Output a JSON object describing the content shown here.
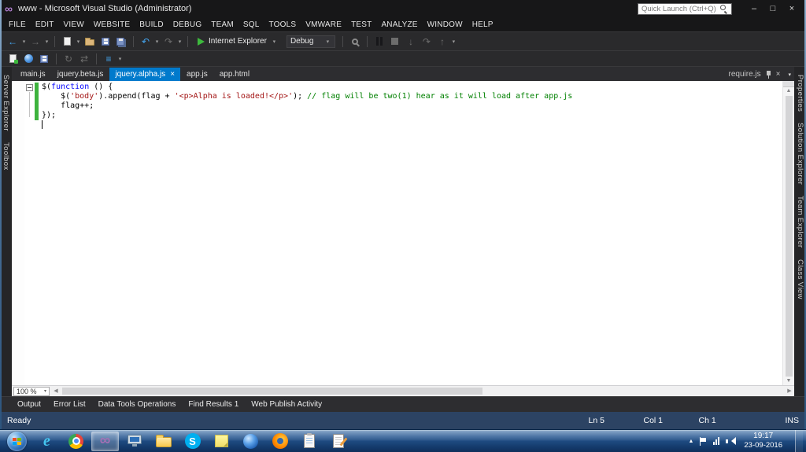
{
  "title_bar": {
    "title": "www - Microsoft Visual Studio (Administrator)",
    "quick_launch_placeholder": "Quick Launch (Ctrl+Q)",
    "window_controls": {
      "minimize": "–",
      "maximize": "□",
      "close": "×"
    }
  },
  "menu_bar": {
    "items": [
      "FILE",
      "EDIT",
      "VIEW",
      "WEBSITE",
      "BUILD",
      "DEBUG",
      "TEAM",
      "SQL",
      "TOOLS",
      "VMWARE",
      "TEST",
      "ANALYZE",
      "WINDOW",
      "HELP"
    ]
  },
  "glyphs": {
    "caret": "▾",
    "close": "×",
    "scroll_up": "▲",
    "scroll_down": "▼",
    "scroll_left": "◀",
    "scroll_right": "▶"
  },
  "toolbar_main": [
    {
      "type": "icon",
      "name": "navigate-back-icon",
      "glyph": "←",
      "color": "#44a6f1"
    },
    {
      "type": "caret",
      "name": "navigate-back-dropdown-icon"
    },
    {
      "type": "icon",
      "name": "navigate-forward-icon",
      "glyph": "→",
      "color": "#6d6d6d"
    },
    {
      "type": "caret",
      "name": "navigate-forward-dropdown-icon"
    },
    {
      "type": "sep"
    },
    {
      "type": "icon",
      "name": "new-file-icon",
      "shape": "page"
    },
    {
      "type": "caret",
      "name": "new-file-dropdown-icon"
    },
    {
      "type": "icon",
      "name": "open-file-icon",
      "shape": "folder"
    },
    {
      "type": "icon",
      "name": "save-icon",
      "shape": "floppy"
    },
    {
      "type": "icon",
      "name": "save-all-icon",
      "shape": "floppy2"
    },
    {
      "type": "sep"
    },
    {
      "type": "icon",
      "name": "undo-icon",
      "glyph": "↶",
      "color": "#44a6f1"
    },
    {
      "type": "caret",
      "name": "undo-dropdown-icon"
    },
    {
      "type": "icon",
      "name": "redo-icon",
      "glyph": "↷",
      "color": "#6d6d6d"
    },
    {
      "type": "caret",
      "name": "redo-dropdown-icon"
    },
    {
      "type": "sep"
    },
    {
      "type": "run",
      "name": "start-debug-button",
      "label": "Internet Explorer"
    },
    {
      "type": "combo",
      "name": "solution-configurations-combobox",
      "label": "Debug"
    },
    {
      "type": "sep"
    },
    {
      "type": "icon",
      "name": "find-in-files-icon",
      "shape": "find"
    },
    {
      "type": "sep"
    },
    {
      "type": "icon",
      "name": "break-all-icon",
      "shape": "pause"
    },
    {
      "type": "icon",
      "name": "stop-debug-icon",
      "shape": "stop"
    },
    {
      "type": "icon",
      "name": "step-into-icon",
      "glyph": "↓",
      "color": "#6d6d6d"
    },
    {
      "type": "icon",
      "name": "step-over-icon",
      "glyph": "↷",
      "color": "#6d6d6d"
    },
    {
      "type": "icon",
      "name": "step-out-icon",
      "glyph": "↑",
      "color": "#6d6d6d"
    },
    {
      "type": "caret",
      "name": "toolbar-overflow-icon"
    }
  ],
  "toolbar_web": [
    {
      "type": "icon",
      "name": "add-new-item-icon",
      "shape": "page-plus"
    },
    {
      "type": "icon",
      "name": "open-web-site-icon",
      "shape": "globe-sm"
    },
    {
      "type": "icon",
      "name": "save-web-icon",
      "shape": "floppy"
    },
    {
      "type": "sep"
    },
    {
      "type": "icon",
      "name": "refresh-icon",
      "glyph": "↻",
      "color": "#6d6d6d"
    },
    {
      "type": "icon",
      "name": "sync-icon",
      "glyph": "⇄",
      "color": "#6d6d6d"
    },
    {
      "type": "sep"
    },
    {
      "type": "icon",
      "name": "task-list-icon",
      "glyph": "≡",
      "color": "#44a6f1"
    },
    {
      "type": "caret",
      "name": "toolbar2-overflow-icon"
    }
  ],
  "left_dock": {
    "tabs": [
      "Server Explorer",
      "Toolbox"
    ]
  },
  "right_dock": {
    "tabs": [
      "Properties",
      "Solution Explorer",
      "Team Explorer",
      "Class View"
    ]
  },
  "editor": {
    "tabs": [
      {
        "label": "main.js",
        "active": false
      },
      {
        "label": "jquery.beta.js",
        "active": false
      },
      {
        "label": "jquery.alpha.js",
        "active": true
      },
      {
        "label": "app.js",
        "active": false
      },
      {
        "label": "app.html",
        "active": false
      }
    ],
    "preview_tab": "require.js",
    "zoom": "100 %",
    "syntax_colors": {
      "plain": "#000000",
      "keyword": "#0000ff",
      "string": "#a31515",
      "comment": "#008000"
    },
    "change_bar_color": "#3eb33e",
    "code_lines": [
      {
        "segments": [
          {
            "c": "p",
            "t": "$("
          },
          {
            "c": "k",
            "t": "function"
          },
          {
            "c": "p",
            "t": " () {"
          }
        ]
      },
      {
        "segments": [
          {
            "c": "p",
            "t": "    $("
          },
          {
            "c": "s",
            "t": "'body'"
          },
          {
            "c": "p",
            "t": ").append(flag + "
          },
          {
            "c": "s",
            "t": "'<p>Alpha is loaded!</p>'"
          },
          {
            "c": "p",
            "t": "); "
          },
          {
            "c": "c",
            "t": "// flag will be two(1) hear as it will load after app.js"
          }
        ]
      },
      {
        "segments": [
          {
            "c": "p",
            "t": "    flag++;"
          }
        ]
      },
      {
        "segments": [
          {
            "c": "p",
            "t": "});"
          }
        ]
      },
      {
        "segments": []
      }
    ]
  },
  "bottom_panel": {
    "tabs": [
      "Output",
      "Error List",
      "Data Tools Operations",
      "Find Results 1",
      "Web Publish Activity"
    ]
  },
  "status_bar": {
    "status": "Ready",
    "line": "Ln 5",
    "column": "Col 1",
    "character": "Ch 1",
    "mode": "INS"
  },
  "taskbar": {
    "time": "19:17",
    "date": "23-09-2016",
    "apps": [
      {
        "name": "internet-explorer",
        "kind": "ie"
      },
      {
        "name": "google-chrome",
        "kind": "chrome"
      },
      {
        "name": "visual-studio",
        "kind": "vs",
        "active": true
      },
      {
        "name": "system-tools",
        "kind": "computer"
      },
      {
        "name": "windows-explorer",
        "kind": "folder"
      },
      {
        "name": "skype",
        "kind": "skype"
      },
      {
        "name": "sticky-notes",
        "kind": "sticky"
      },
      {
        "name": "blue-globe-app",
        "kind": "globe"
      },
      {
        "name": "firefox",
        "kind": "firefox"
      },
      {
        "name": "notes-app",
        "kind": "clipboard"
      },
      {
        "name": "text-editor",
        "kind": "docpen"
      }
    ],
    "tray_icons": [
      {
        "name": "hidden-icons-expander",
        "glyph": "▲"
      },
      {
        "name": "action-center-icon",
        "kind": "flag"
      },
      {
        "name": "network-icon",
        "kind": "network"
      },
      {
        "name": "volume-icon",
        "kind": "speaker"
      }
    ]
  },
  "colors": {
    "accent_blue": "#007acc",
    "run_green": "#3db93d",
    "taskbar_blue": "#1e4a80"
  }
}
